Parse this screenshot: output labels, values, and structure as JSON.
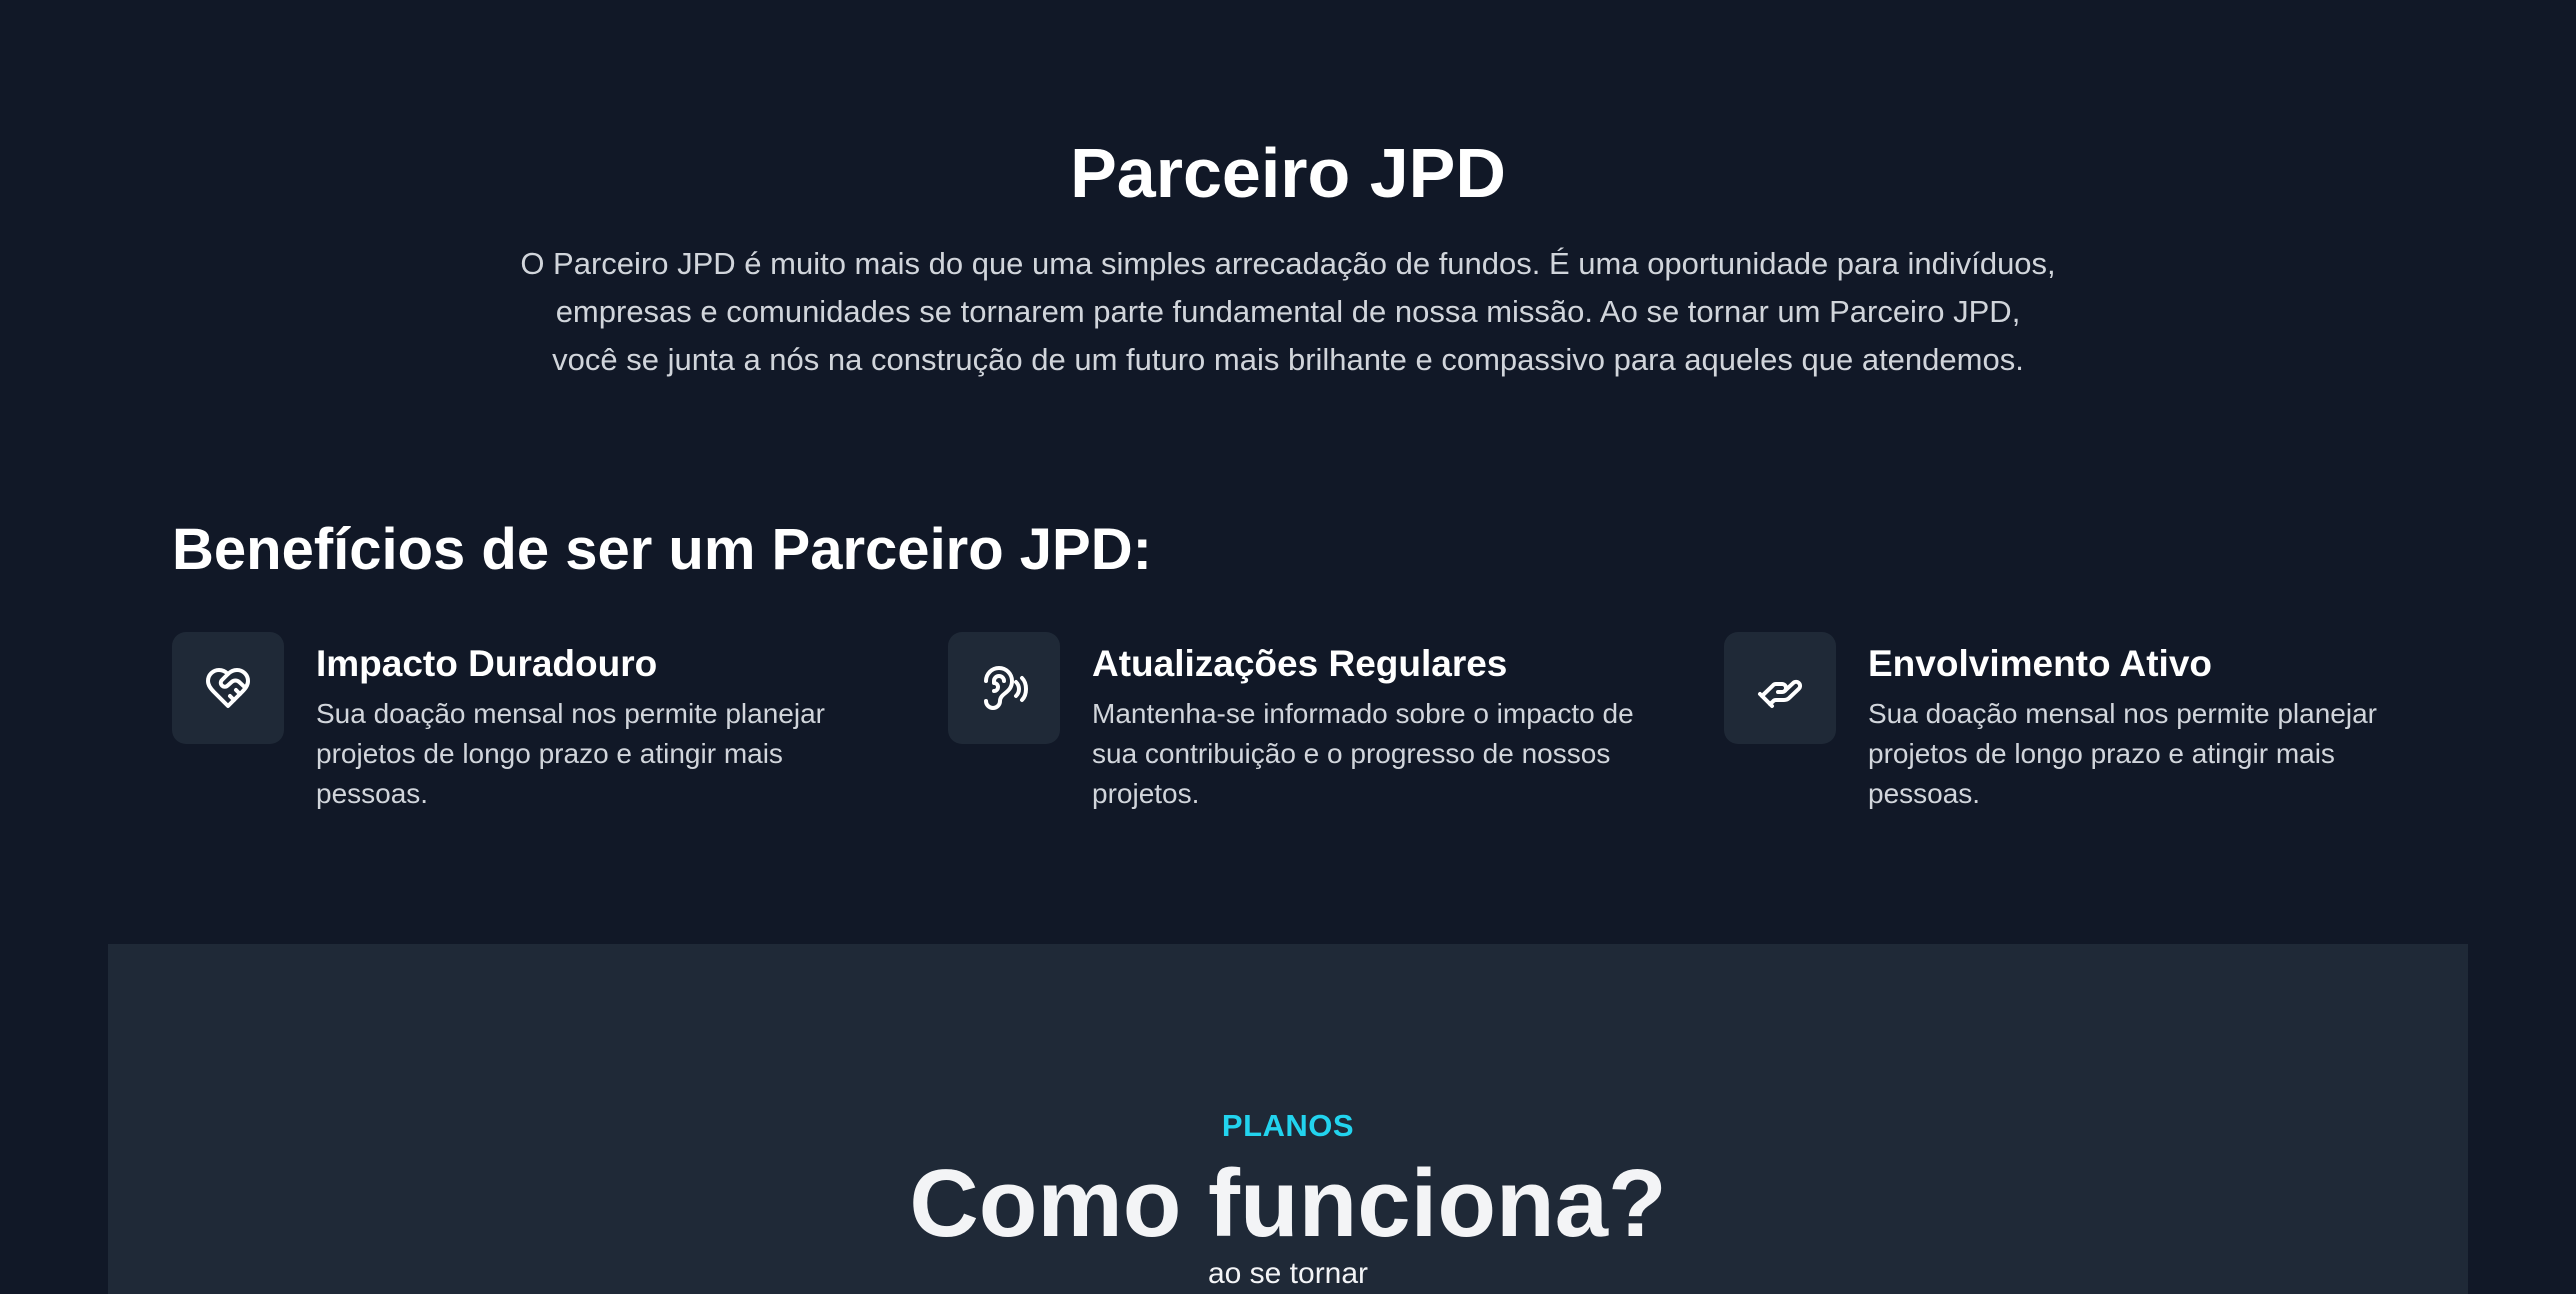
{
  "hero": {
    "title": "Parceiro JPD",
    "description": "O Parceiro JPD é muito mais do que uma simples arrecadação de fundos. É uma oportunidade para indivíduos, empresas e comunidades se tornarem parte fundamental de nossa missão. Ao se tornar um Parceiro JPD, você se junta a nós na construção de um futuro mais brilhante e compassivo para aqueles que atendemos."
  },
  "benefits": {
    "title": "Benefícios de ser um Parceiro JPD:",
    "items": [
      {
        "icon": "heart-handshake-icon",
        "title": "Impacto Duradouro",
        "text": "Sua doação mensal nos permite planejar projetos de longo prazo e atingir mais pessoas."
      },
      {
        "icon": "speaking-head-icon",
        "title": "Atualizações Regulares",
        "text": "Mantenha-se informado sobre o impacto de sua contribuição e o progresso de nossos projetos."
      },
      {
        "icon": "giving-hand-icon",
        "title": "Envolvimento Ativo",
        "text": "Sua doação mensal nos permite planejar projetos de longo prazo e atingir mais pessoas."
      }
    ]
  },
  "plans": {
    "eyebrow": "PLANOS",
    "title": "Como funciona?",
    "subtitle": "ao se tornar"
  },
  "colors": {
    "background": "#111827",
    "card": "#1f2937",
    "accent": "#22d3ee",
    "muted_text": "#d1d5db"
  }
}
